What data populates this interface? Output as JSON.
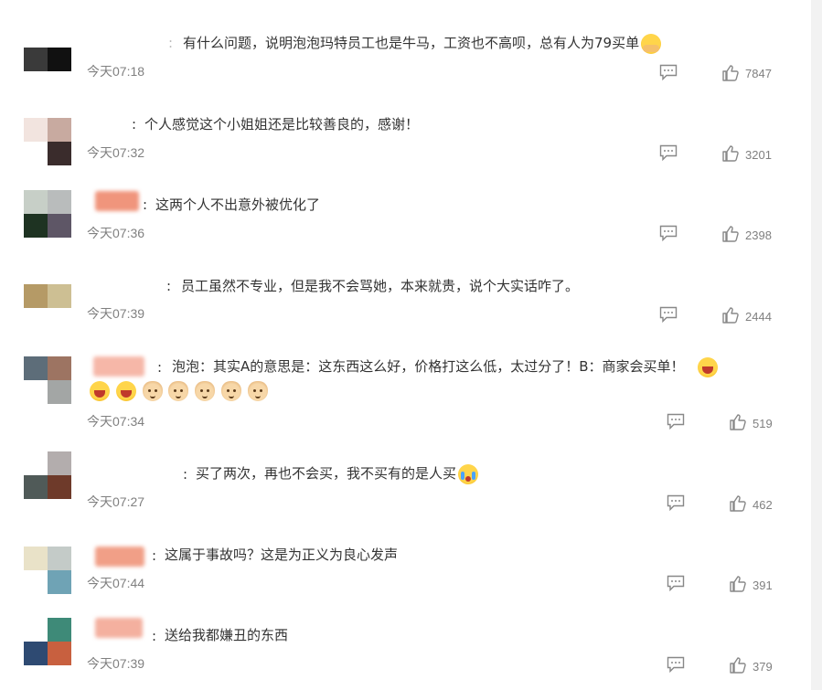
{
  "comments": [
    {
      "text": "有什么问题，说明泡泡玛特员工也是牛马，工资也不高呗，总有人为79买单",
      "emoji": [
        "facepalm"
      ],
      "time": "今天07:18",
      "likes": "7847",
      "avatar_colors": [
        "#3a3a3a",
        "#111111",
        "#ffffff",
        "#ffffff"
      ],
      "name_color": ""
    },
    {
      "text": "个人感觉这个小姐姐还是比较善良的，感谢！",
      "emoji": [],
      "time": "今天07:32",
      "likes": "3201",
      "avatar_colors": [
        "#f2e4df",
        "#c8aaa0",
        "#ffffff",
        "#3a2c2c"
      ],
      "name_color": ""
    },
    {
      "text": "这两个人不出意外被优化了",
      "emoji": [],
      "time": "今天07:36",
      "likes": "2398",
      "avatar_colors": [
        "#c7cfc7",
        "#b9bcbc",
        "#1e3322",
        "#5e5666"
      ],
      "name_color": "#f0957c"
    },
    {
      "text": "员工虽然不专业，但是我不会骂她，本来就贵，说个大实话咋了。",
      "emoji": [],
      "time": "今天07:39",
      "likes": "2444",
      "avatar_colors": [
        "#ffffff",
        "#ffffff",
        "#b59a66",
        "#cdbf93"
      ],
      "name_color": ""
    },
    {
      "text": "泡泡：其实A的意思是：这东西这么好，价格打这么低，太过分了！B：商家会买单！",
      "emoji": [
        "laugh"
      ],
      "emoji_line2": [
        "laugh",
        "laugh",
        "cat",
        "cat",
        "cat",
        "cat",
        "cat"
      ],
      "time": "今天07:34",
      "likes": "519",
      "avatar_colors": [
        "#5d6d79",
        "#9d7462",
        "#ffffff",
        "#a3a6a5"
      ],
      "name_color": "#f6b7a8"
    },
    {
      "text": "买了两次，再也不会买，我不买有的是人买",
      "emoji": [
        "cry"
      ],
      "time": "今天07:27",
      "likes": "462",
      "avatar_colors": [
        "#ffffff",
        "#b3adad",
        "#505a58",
        "#6e3a2a"
      ],
      "name_color": ""
    },
    {
      "text": "这属于事故吗？这是为正义为良心发声",
      "emoji": [],
      "time": "今天07:44",
      "likes": "391",
      "avatar_colors": [
        "#e9e2c8",
        "#c4cbc8",
        "#ffffff",
        "#6fa3b5"
      ],
      "name_color": "#f19f87"
    },
    {
      "text": "送给我都嫌丑的东西",
      "emoji": [],
      "time": "今天07:39",
      "likes": "379",
      "avatar_colors": [
        "#ffffff",
        "#3e8a78",
        "#2e4a72",
        "#c8603f"
      ],
      "name_color": "#f4b09f"
    }
  ]
}
